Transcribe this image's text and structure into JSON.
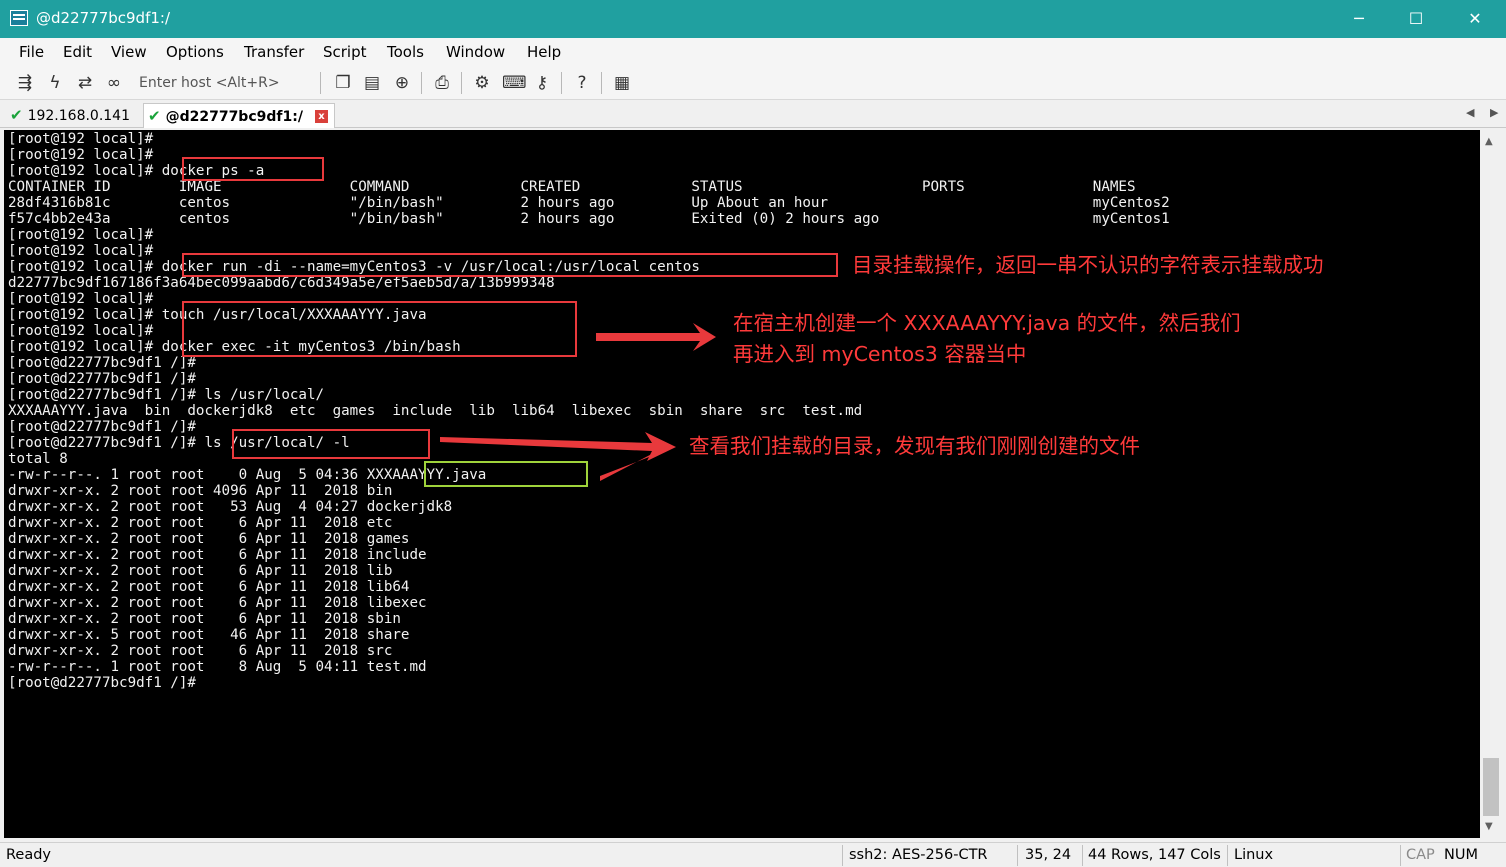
{
  "window": {
    "title": "@d22777bc9df1:/",
    "minimize_glyph": "─",
    "maximize_glyph": "☐",
    "close_glyph": "✕"
  },
  "menu": [
    "File",
    "Edit",
    "View",
    "Options",
    "Transfer",
    "Script",
    "Tools",
    "Window",
    "Help"
  ],
  "toolbar": {
    "host_placeholder": "Enter host <Alt+R>",
    "icons": [
      "connect-icon",
      "quick-connect-icon",
      "reconnect-icon",
      "disconnect-icon",
      "copy-icon",
      "paste-icon",
      "find-icon",
      "print-icon",
      "settings-icon",
      "keymap-icon",
      "sftp-icon",
      "help-icon",
      "about-icon"
    ]
  },
  "tabs": [
    {
      "label": "192.168.0.141",
      "active": false
    },
    {
      "label": "@d22777bc9df1:/",
      "active": true
    }
  ],
  "tab_close_glyph": "x",
  "terminal_lines": [
    "[root@192 local]#",
    "[root@192 local]#",
    "[root@192 local]# docker ps -a",
    "CONTAINER ID        IMAGE               COMMAND             CREATED             STATUS                     PORTS               NAMES",
    "28df4316b81c        centos              \"/bin/bash\"         2 hours ago         Up About an hour                               myCentos2",
    "f57c4bb2e43a        centos              \"/bin/bash\"         2 hours ago         Exited (0) 2 hours ago                         myCentos1",
    "[root@192 local]#",
    "[root@192 local]#",
    "[root@192 local]# docker run -di --name=myCentos3 -v /usr/local:/usr/local centos",
    "d22777bc9df167186f3a64bec099aabd6/c6d349a5e/ef5aeb5d/a/13b999348",
    "[root@192 local]#",
    "[root@192 local]# touch /usr/local/XXXAAAYYY.java",
    "[root@192 local]#",
    "[root@192 local]# docker exec -it myCentos3 /bin/bash",
    "[root@d22777bc9df1 /]#",
    "[root@d22777bc9df1 /]#",
    "[root@d22777bc9df1 /]# ls /usr/local/",
    "XXXAAAYYY.java  bin  dockerjdk8  etc  games  include  lib  lib64  libexec  sbin  share  src  test.md",
    "[root@d22777bc9df1 /]#",
    "[root@d22777bc9df1 /]# ls /usr/local/ -l",
    "total 8",
    "-rw-r--r--. 1 root root    0 Aug  5 04:36 XXXAAAYYY.java",
    "drwxr-xr-x. 2 root root 4096 Apr 11  2018 bin",
    "drwxr-xr-x. 2 root root   53 Aug  4 04:27 dockerjdk8",
    "drwxr-xr-x. 2 root root    6 Apr 11  2018 etc",
    "drwxr-xr-x. 2 root root    6 Apr 11  2018 games",
    "drwxr-xr-x. 2 root root    6 Apr 11  2018 include",
    "drwxr-xr-x. 2 root root    6 Apr 11  2018 lib",
    "drwxr-xr-x. 2 root root    6 Apr 11  2018 lib64",
    "drwxr-xr-x. 2 root root    6 Apr 11  2018 libexec",
    "drwxr-xr-x. 2 root root    6 Apr 11  2018 sbin",
    "drwxr-xr-x. 5 root root   46 Apr 11  2018 share",
    "drwxr-xr-x. 2 root root    6 Apr 11  2018 src",
    "-rw-r--r--. 1 root root    8 Aug  5 04:11 test.md",
    "[root@d22777bc9df1 /]#"
  ],
  "annotations": {
    "mount_note": "目录挂载操作，返回一串不认识的字符表示挂载成功",
    "touch_note_line1": "在宿主机创建一个 XXXAAAYYY.java 的文件，然后我们",
    "touch_note_line2": "再进入到 myCentos3 容器当中",
    "ls_note": "查看我们挂载的目录，发现有我们刚刚创建的文件"
  },
  "colors": {
    "titlebar": "#20a0a0",
    "highlight_red": "#e8393c",
    "highlight_green": "#9fd33b",
    "annotation_text": "#ff3a3a",
    "terminal_bg": "#000000",
    "terminal_fg": "#f2f2f2",
    "tab_check": "#1aa33a"
  },
  "status": {
    "ready": "Ready",
    "cipher": "ssh2: AES-256-CTR",
    "cursor": "35,  24",
    "size": "44 Rows, 147 Cols",
    "os": "Linux",
    "cap": "CAP",
    "num": "NUM"
  }
}
